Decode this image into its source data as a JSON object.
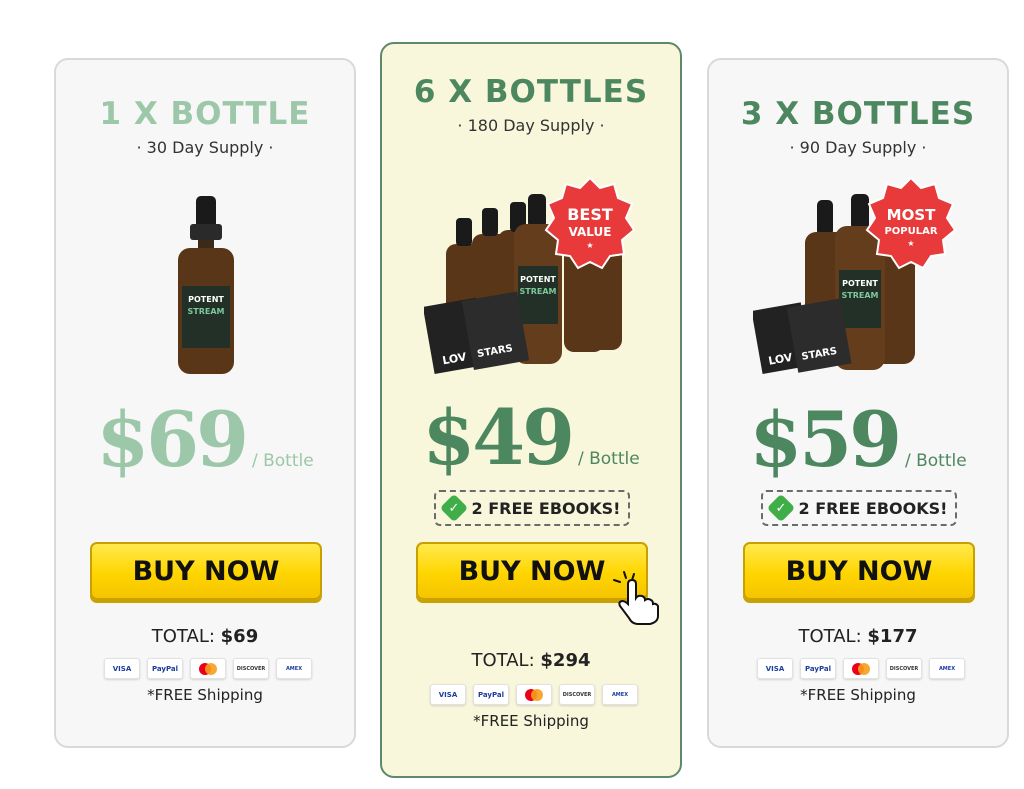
{
  "cards": [
    {
      "title": "1 X BOTTLE",
      "supply": "· 30 Day Supply ·",
      "price": "$69",
      "per": "/ Bottle",
      "buy_label": "BUY NOW",
      "total_label": "TOTAL:",
      "total_value": "$69",
      "shipping": "*FREE Shipping"
    },
    {
      "title": "6 X BOTTLES",
      "supply": "· 180 Day Supply ·",
      "badge_line1": "BEST",
      "badge_line2": "VALUE",
      "price": "$49",
      "per": "/ Bottle",
      "ebooks": "2 FREE EBOOKS!",
      "buy_label": "BUY NOW",
      "total_label": "TOTAL:",
      "total_value": "$294",
      "shipping": "*FREE Shipping"
    },
    {
      "title": "3 X BOTTLES",
      "supply": "· 90 Day Supply ·",
      "badge_line1": "MOST",
      "badge_line2": "POPULAR",
      "price": "$59",
      "per": "/ Bottle",
      "ebooks": "2 FREE EBOOKS!",
      "buy_label": "BUY NOW",
      "total_label": "TOTAL:",
      "total_value": "$177",
      "shipping": "*FREE Shipping"
    }
  ],
  "bottle_label": {
    "brand_line1": "POTENT",
    "brand_line2": "STREAM"
  },
  "ebook_labels": [
    "LOV",
    "STARS"
  ],
  "payment_methods": [
    "VISA",
    "PayPal",
    "MC",
    "DISCOVER",
    "AMEX"
  ],
  "colors": {
    "accent_green": "#4d8760",
    "light_green": "#9cc7a8",
    "badge_red": "#e83a3a",
    "button_yellow": "#ffd500",
    "featured_bg": "#f8f7dc"
  }
}
